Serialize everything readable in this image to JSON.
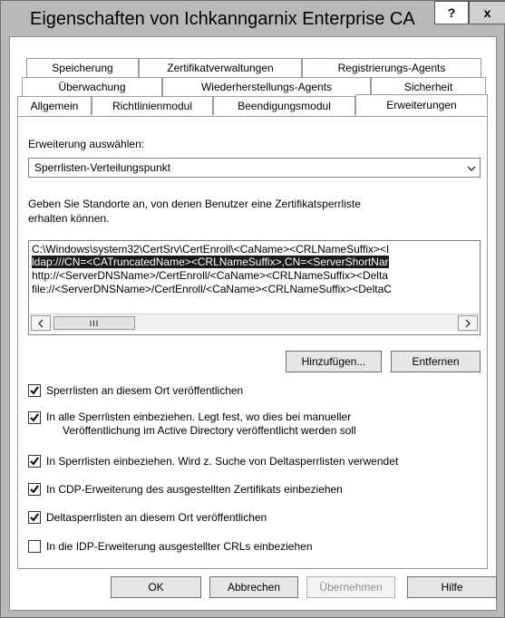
{
  "window": {
    "title": "Eigenschaften von Ichkanngarnix Enterprise CA",
    "help_label": "?",
    "close_label": "x"
  },
  "tabs": {
    "row1": [
      "Speicherung",
      "Zertifikatverwaltungen",
      "Registrierungs-Agents"
    ],
    "row2": [
      "Überwachung",
      "Wiederherstellungs-Agents",
      "Sicherheit"
    ],
    "row3": [
      "Allgemein",
      "Richtlinienmodul",
      "Beendigungsmodul",
      "Erweiterungen"
    ],
    "active": "Erweiterungen"
  },
  "extension": {
    "select_label": "Erweiterung auswählen:",
    "selected_value": "Sperrlisten-Verteilungspunkt",
    "description_line1": "Geben Sie Standorte an, von denen Benutzer eine Zertifikatsperrliste",
    "description_line2": "erhalten können.",
    "locations": [
      "C:\\Windows\\system32\\CertSrv\\CertEnroll\\<CaName><CRLNameSuffix><I",
      "ldap:///CN=<CATruncatedName><CRLNameSuffix>,CN=<ServerShortNar",
      "http://<ServerDNSName>/CertEnroll/<CaName><CRLNameSuffix><Delta",
      "file://<ServerDNSName>/CertEnroll/<CaName><CRLNameSuffix><DeltaC"
    ],
    "selected_location_index": 1,
    "scroll_thumb_label": "III"
  },
  "buttons": {
    "add": "Hinzufügen...",
    "remove": "Entfernen",
    "ok": "OK",
    "cancel": "Abbrechen",
    "apply": "Übernehmen",
    "help": "Hilfe"
  },
  "options": [
    {
      "line1": "Sperrlisten an diesem Ort veröffentlichen",
      "line2": "",
      "checked": true
    },
    {
      "line1": "In alle Sperrlisten einbeziehen. Legt fest, wo dies bei manueller",
      "line2": "Veröffentlichung im Active Directory veröffentlicht werden soll",
      "checked": true
    },
    {
      "line1": "In Sperrlisten einbeziehen. Wird z. Suche von Deltasperrlisten verwendet",
      "line2": "",
      "checked": true
    },
    {
      "line1": "In CDP-Erweiterung des ausgestellten Zertifikats einbeziehen",
      "line2": "",
      "checked": true
    },
    {
      "line1": "Deltasperrlisten an diesem Ort veröffentlichen",
      "line2": "",
      "checked": true
    },
    {
      "line1": "In die IDP-Erweiterung ausgestellter CRLs einbeziehen",
      "line2": "",
      "checked": false
    }
  ]
}
